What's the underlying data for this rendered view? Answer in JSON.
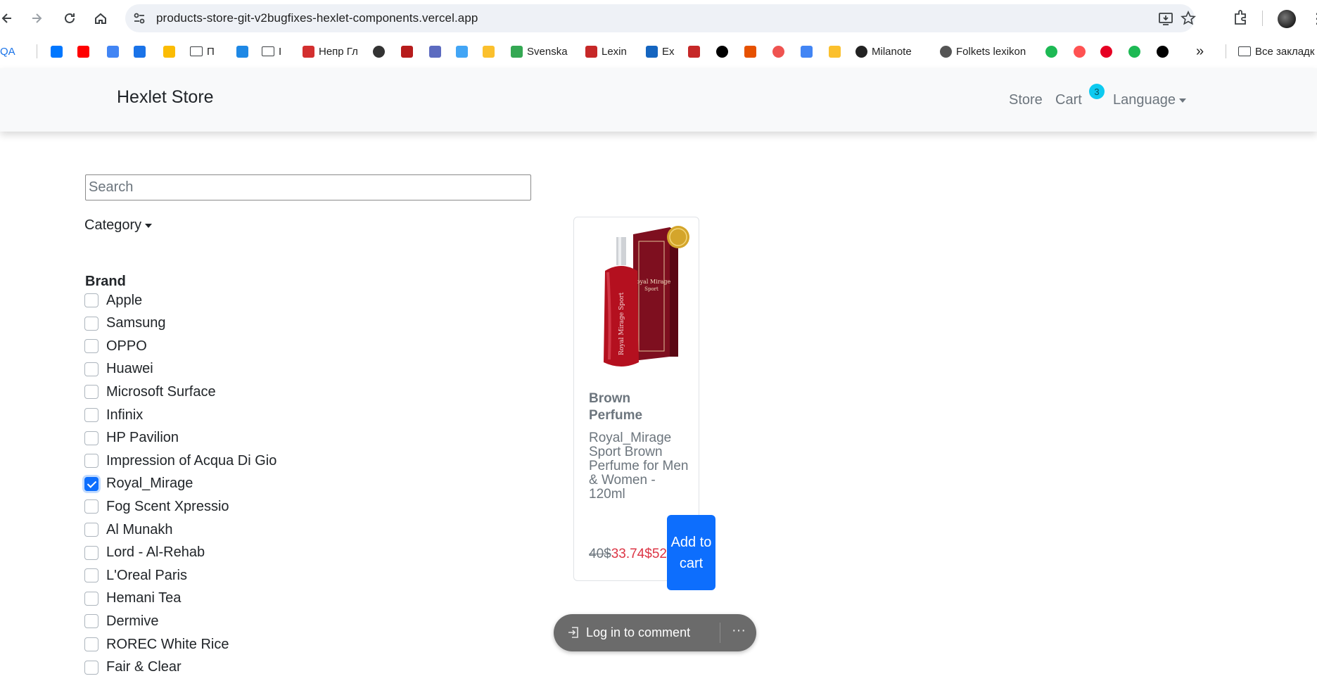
{
  "browser": {
    "url": "products-store-git-v2bugfixes-hexlet-components.vercel.app",
    "bookmarks": [
      {
        "label": "QA",
        "icon": "qa-text-icon"
      },
      {
        "label": "",
        "icon": "vk-icon",
        "color": "#0077ff"
      },
      {
        "label": "",
        "icon": "youtube-icon",
        "color": "#ff0000"
      },
      {
        "label": "",
        "icon": "translate-icon",
        "color": "#4285f4"
      },
      {
        "label": "",
        "icon": "refresh-swirl-icon",
        "color": "#1a73e8"
      },
      {
        "label": "",
        "icon": "google-drive-icon",
        "color": "#fbbc04"
      },
      {
        "label": "П",
        "icon": "folder-icon"
      },
      {
        "label": "",
        "icon": "wp-icon",
        "color": "#1e88e5"
      },
      {
        "label": "I",
        "icon": "folder-icon"
      },
      {
        "label": "Непр Гл",
        "icon": "flag-icon",
        "color": "#d32f2f"
      },
      {
        "label": "",
        "icon": "circle-logo-icon",
        "color": "#333333"
      },
      {
        "label": "",
        "icon": "shield-crest-icon",
        "color": "#b71c1c"
      },
      {
        "label": "",
        "icon": "globe-crest-icon",
        "color": "#5c6bc0"
      },
      {
        "label": "",
        "icon": "puzzle-blue-icon",
        "color": "#42a5f5"
      },
      {
        "label": "",
        "icon": "sun-icon",
        "color": "#fbc02d"
      },
      {
        "label": "Svenska",
        "icon": "google-drive-icon",
        "color": "#34a853"
      },
      {
        "label": "Lexin",
        "icon": "lexin-icon",
        "color": "#c62828"
      },
      {
        "label": "Ex",
        "icon": "doc-icon",
        "color": "#1565c0"
      },
      {
        "label": "",
        "icon": "checkmark-icon",
        "color": "#c62828"
      },
      {
        "label": "",
        "icon": "plus-circle-icon",
        "color": "#000000"
      },
      {
        "label": "",
        "icon": "book-icon",
        "color": "#e65100"
      },
      {
        "label": "",
        "icon": "y-icon",
        "color": "#ef5350"
      },
      {
        "label": "",
        "icon": "google-icon",
        "color": "#4285f4"
      },
      {
        "label": "",
        "icon": "mail-icon",
        "color": "#fbc02d"
      },
      {
        "label": "Milanote",
        "icon": "milanote-icon",
        "color": "#222222"
      },
      {
        "label": "Folkets lexikon",
        "icon": "folkets-icon",
        "color": "#555555"
      },
      {
        "label": "",
        "icon": "spotify-icon",
        "color": "#1db954"
      },
      {
        "label": "",
        "icon": "yandex-icon",
        "color": "#ff5252"
      },
      {
        "label": "",
        "icon": "pinterest-icon",
        "color": "#e60023"
      },
      {
        "label": "",
        "icon": "s-green-icon",
        "color": "#1db954"
      },
      {
        "label": "",
        "icon": "a-black-icon",
        "color": "#000000"
      }
    ],
    "overflow_label": "»",
    "all_bookmarks_label": "Все закладк"
  },
  "navbar": {
    "brand": "Hexlet Store",
    "store": "Store",
    "cart": "Cart",
    "cart_count": "3",
    "language": "Language"
  },
  "filters": {
    "search_placeholder": "Search",
    "category_label": "Category",
    "brand_heading": "Brand",
    "brands": [
      {
        "label": "Apple",
        "checked": false
      },
      {
        "label": "Samsung",
        "checked": false
      },
      {
        "label": "OPPO",
        "checked": false
      },
      {
        "label": "Huawei",
        "checked": false
      },
      {
        "label": "Microsoft Surface",
        "checked": false
      },
      {
        "label": "Infinix",
        "checked": false
      },
      {
        "label": "HP Pavilion",
        "checked": false
      },
      {
        "label": "Impression of Acqua Di Gio",
        "checked": false
      },
      {
        "label": "Royal_Mirage",
        "checked": true
      },
      {
        "label": "Fog Scent Xpressio",
        "checked": false
      },
      {
        "label": "Al Munakh",
        "checked": false
      },
      {
        "label": "Lord - Al-Rehab",
        "checked": false
      },
      {
        "label": "L'Oreal Paris",
        "checked": false
      },
      {
        "label": "Hemani Tea",
        "checked": false
      },
      {
        "label": "Dermive",
        "checked": false
      },
      {
        "label": "ROREC White Rice",
        "checked": false
      },
      {
        "label": "Fair & Clear",
        "checked": false
      }
    ]
  },
  "product": {
    "title": "Brown Perfume",
    "description": "Royal_Mirage Sport Brown Perfume for Men & Women - 120ml",
    "old_price": "40$",
    "new_price": "33.74$",
    "clipped_price": "52",
    "add_to_cart": "Add to cart",
    "image_alt": "red perfume bottle with box",
    "box_text": "Royal Mirage Sport",
    "bottle_text": "Royal Mirage Sport"
  },
  "comment": {
    "login_label": "Log in to comment",
    "more_label": "···"
  }
}
